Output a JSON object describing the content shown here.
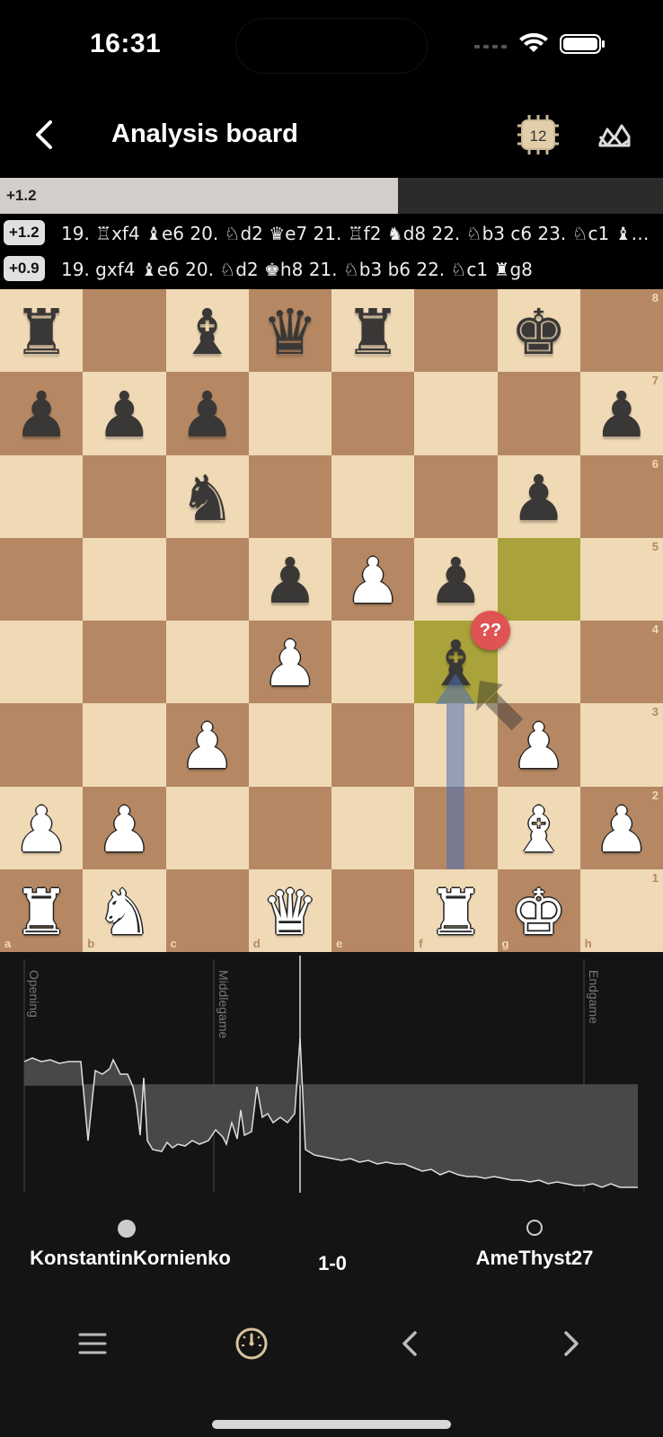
{
  "status_bar": {
    "time": "16:31"
  },
  "header": {
    "title": "Analysis board",
    "engine_depth": "12"
  },
  "eval_bar": {
    "label": "+1.2",
    "white_fraction": 0.6
  },
  "engine_lines": [
    {
      "eval": "+1.2",
      "moves": "19. ♖xf4 ♝e6 20. ♘d2 ♛e7 21. ♖f2 ♞d8 22. ♘b3 c6 23. ♘c1 ♝d…"
    },
    {
      "eval": "+0.9",
      "moves": "19. gxf4 ♝e6 20. ♘d2 ♚h8 21. ♘b3 b6 22. ♘c1 ♜g8"
    }
  ],
  "board": {
    "files": [
      "a",
      "b",
      "c",
      "d",
      "e",
      "f",
      "g",
      "h"
    ],
    "ranks": [
      "8",
      "7",
      "6",
      "5",
      "4",
      "3",
      "2",
      "1"
    ],
    "highlight": [
      "f4",
      "g5"
    ],
    "annotation": "??",
    "pieces": [
      {
        "sq": "a8",
        "c": "b",
        "p": "♜"
      },
      {
        "sq": "c8",
        "c": "b",
        "p": "♝"
      },
      {
        "sq": "d8",
        "c": "b",
        "p": "♛"
      },
      {
        "sq": "e8",
        "c": "b",
        "p": "♜"
      },
      {
        "sq": "g8",
        "c": "b",
        "p": "♚"
      },
      {
        "sq": "a7",
        "c": "b",
        "p": "♟"
      },
      {
        "sq": "b7",
        "c": "b",
        "p": "♟"
      },
      {
        "sq": "c7",
        "c": "b",
        "p": "♟"
      },
      {
        "sq": "h7",
        "c": "b",
        "p": "♟"
      },
      {
        "sq": "c6",
        "c": "b",
        "p": "♞"
      },
      {
        "sq": "g6",
        "c": "b",
        "p": "♟"
      },
      {
        "sq": "d5",
        "c": "b",
        "p": "♟"
      },
      {
        "sq": "e5",
        "c": "w",
        "p": "♟"
      },
      {
        "sq": "f5",
        "c": "b",
        "p": "♟"
      },
      {
        "sq": "d4",
        "c": "w",
        "p": "♟"
      },
      {
        "sq": "f4",
        "c": "b",
        "p": "♝"
      },
      {
        "sq": "c3",
        "c": "w",
        "p": "♟"
      },
      {
        "sq": "g3",
        "c": "w",
        "p": "♟"
      },
      {
        "sq": "a2",
        "c": "w",
        "p": "♟"
      },
      {
        "sq": "b2",
        "c": "w",
        "p": "♟"
      },
      {
        "sq": "g2",
        "c": "w",
        "p": "♝"
      },
      {
        "sq": "h2",
        "c": "w",
        "p": "♟"
      },
      {
        "sq": "a1",
        "c": "w",
        "p": "♜"
      },
      {
        "sq": "b1",
        "c": "w",
        "p": "♞"
      },
      {
        "sq": "d1",
        "c": "w",
        "p": "♛"
      },
      {
        "sq": "f1",
        "c": "w",
        "p": "♜"
      },
      {
        "sq": "g1",
        "c": "w",
        "p": "♚"
      }
    ]
  },
  "graph": {
    "phases": [
      "Opening",
      "Middlegame",
      "Endgame"
    ]
  },
  "players": {
    "white": "KonstantinKornienko",
    "black": "AmeThyst27",
    "result": "1-0"
  }
}
